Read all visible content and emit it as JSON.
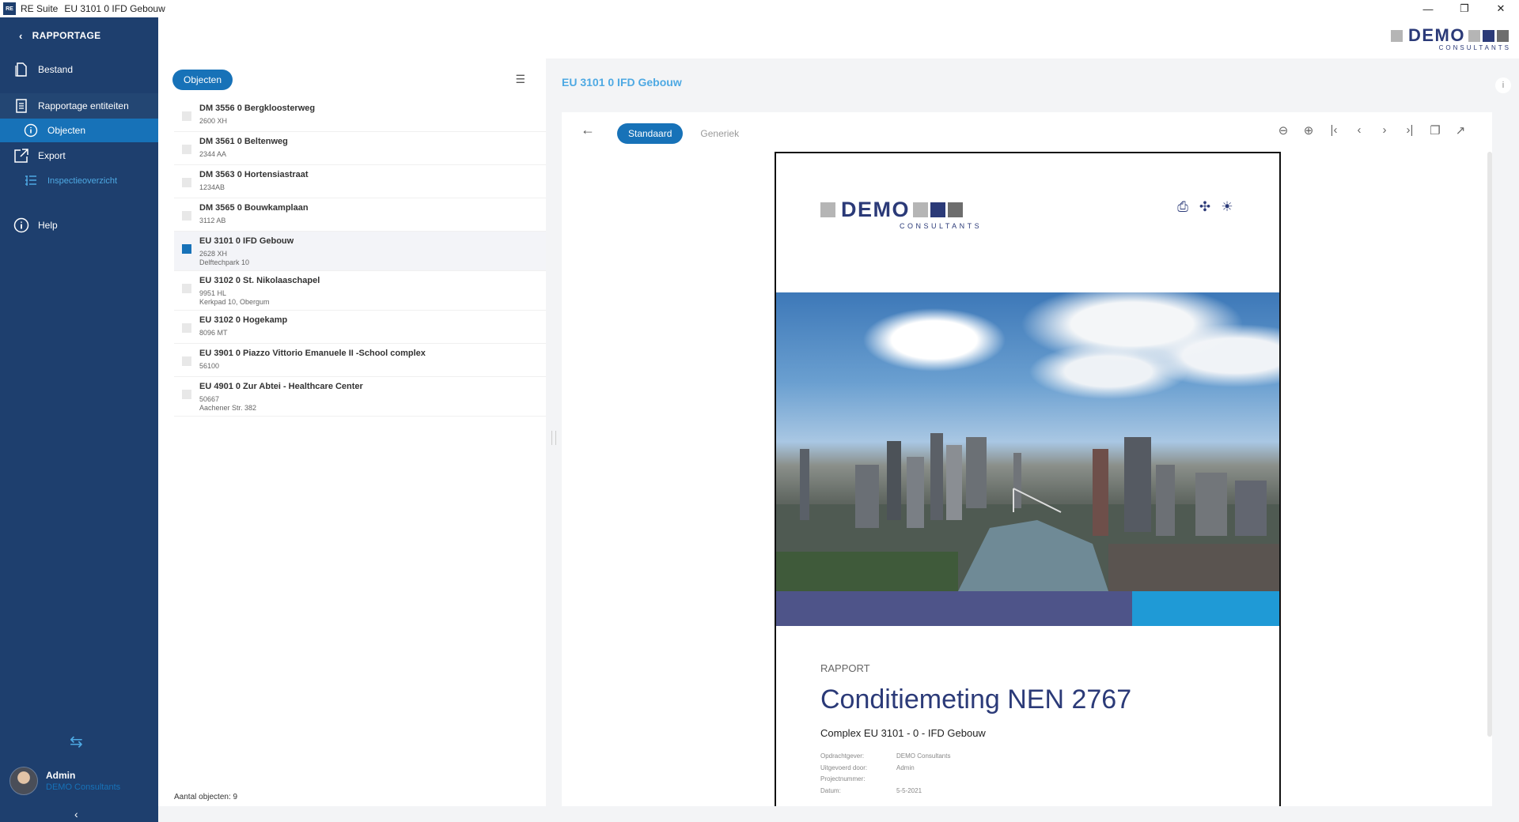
{
  "window": {
    "app_name": "RE Suite",
    "doc_title": "EU 3101 0 IFD Gebouw",
    "controls": {
      "minimize": "—",
      "maximize": "❐",
      "close": "✕"
    }
  },
  "sidebar": {
    "back_label": "RAPPORTAGE",
    "items": {
      "bestand": "Bestand",
      "rapportage_entiteiten": "Rapportage entiteiten",
      "objecten": "Objecten",
      "export": "Export",
      "inspectieoverzicht": "Inspectieoverzicht",
      "help": "Help"
    },
    "user": {
      "name": "Admin",
      "org": "DEMO Consultants"
    }
  },
  "brand": {
    "name": "DEMO",
    "tagline": "CONSULTANTS",
    "colors": {
      "grey": "#b5b5b5",
      "navy": "#2b3a78",
      "dark": "#6d6d6d",
      "blue": "#1772b8"
    }
  },
  "list": {
    "header_pill": "Objecten",
    "items": [
      {
        "title": "DM 3556 0 Bergkloosterweg",
        "line1": "2600 XH",
        "line2": ""
      },
      {
        "title": "DM 3561 0 Beltenweg",
        "line1": "2344 AA",
        "line2": ""
      },
      {
        "title": "DM 3563 0 Hortensiastraat",
        "line1": "1234AB",
        "line2": ""
      },
      {
        "title": "DM 3565 0 Bouwkamplaan",
        "line1": "3112 AB",
        "line2": ""
      },
      {
        "title": "EU 3101 0 IFD Gebouw",
        "line1": "2628 XH",
        "line2": "Delftechpark 10"
      },
      {
        "title": "EU 3102 0 St. Nikolaaschapel",
        "line1": "9951 HL",
        "line2": "Kerkpad 10, Obergum"
      },
      {
        "title": "EU 3102 0 Hogekamp",
        "line1": "8096 MT",
        "line2": ""
      },
      {
        "title": "EU 3901 0 Piazzo Vittorio Emanuele II -School complex",
        "line1": "56100",
        "line2": ""
      },
      {
        "title": "EU 4901 0 Zur Abtei - Healthcare Center",
        "line1": "50667",
        "line2": "Aachener Str. 382"
      }
    ],
    "footer": "Aantal objecten: 9"
  },
  "main": {
    "title": "EU 3101 0 IFD Gebouw",
    "info": "i",
    "tabs": {
      "standaard": "Standaard",
      "generiek": "Generiek"
    }
  },
  "document": {
    "kicker": "RAPPORT",
    "title": "Conditiemeting NEN 2767",
    "subtitle": "Complex EU 3101 - 0 - IFD Gebouw",
    "meta": [
      {
        "key": "Opdrachtgever:",
        "value": "DEMO Consultants"
      },
      {
        "key": "Uitgevoerd door:",
        "value": "Admin"
      },
      {
        "key": "Projectnummer:",
        "value": ""
      },
      {
        "key": "Datum:",
        "value": "5-5-2021"
      }
    ]
  }
}
